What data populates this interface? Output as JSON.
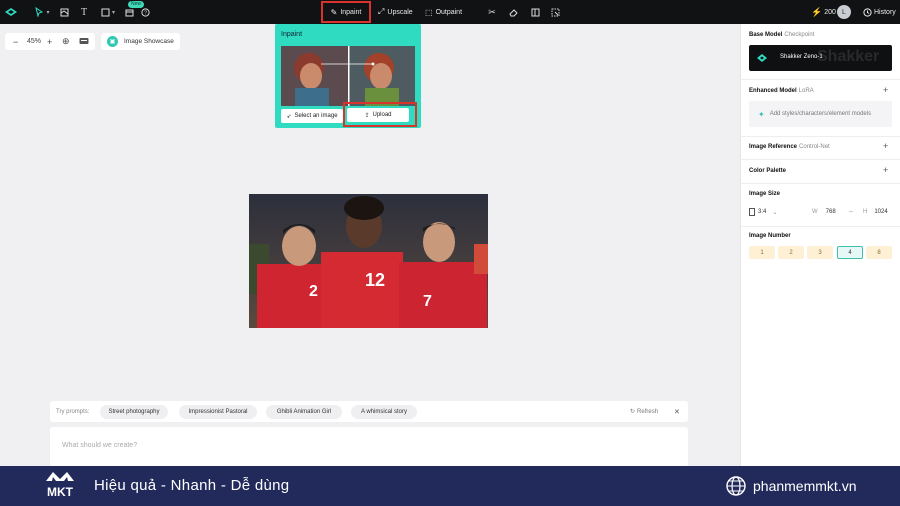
{
  "toolbar": {
    "new_badge": "New",
    "inpaint_label": "Inpaint",
    "upscale_label": "Upscale",
    "outpaint_label": "Outpaint",
    "credits": "200",
    "avatar_initial": "L",
    "history_label": "History"
  },
  "canvas": {
    "zoom": "45%",
    "showcase_label": "Image Showcase"
  },
  "inpaint_popup": {
    "title": "Inpaint",
    "select_label": "Select an image",
    "upload_label": "Upload"
  },
  "prompts": {
    "try_label": "Try prompts:",
    "chips": [
      "Street photography",
      "Impressionist Pastoral",
      "Ghibli Animation Girl",
      "A whimsical story"
    ],
    "refresh_label": "Refresh",
    "input_placeholder": "What should we create?"
  },
  "panel": {
    "base_model_title": "Base Model",
    "base_model_sub": "Checkpoint",
    "model_name": "Shakker Zeno-1",
    "model_watermark": "Shakker",
    "enhanced_model_title": "Enhanced Model",
    "enhanced_model_sub": "LoRA",
    "lora_placeholder": "Add styles/characters/element models",
    "image_reference_title": "Image Reference",
    "image_reference_sub": "Control-Net",
    "color_palette_title": "Color Palette",
    "image_size_title": "Image Size",
    "ratio": "3:4",
    "width_label": "W",
    "width_value": "768",
    "height_label": "H",
    "height_value": "1024",
    "image_number_title": "Image Number",
    "numbers": [
      "1",
      "2",
      "3",
      "4",
      "8"
    ],
    "selected_number": "4"
  },
  "banner": {
    "brand": "MKT",
    "slogan": "Hiệu quả - Nhanh - Dễ dùng",
    "website": "phanmemmkt.vn"
  },
  "colors": {
    "accent": "#30dcc1",
    "highlight_border": "#d8332c",
    "topbar": "#111214",
    "banner": "#212a5b"
  }
}
